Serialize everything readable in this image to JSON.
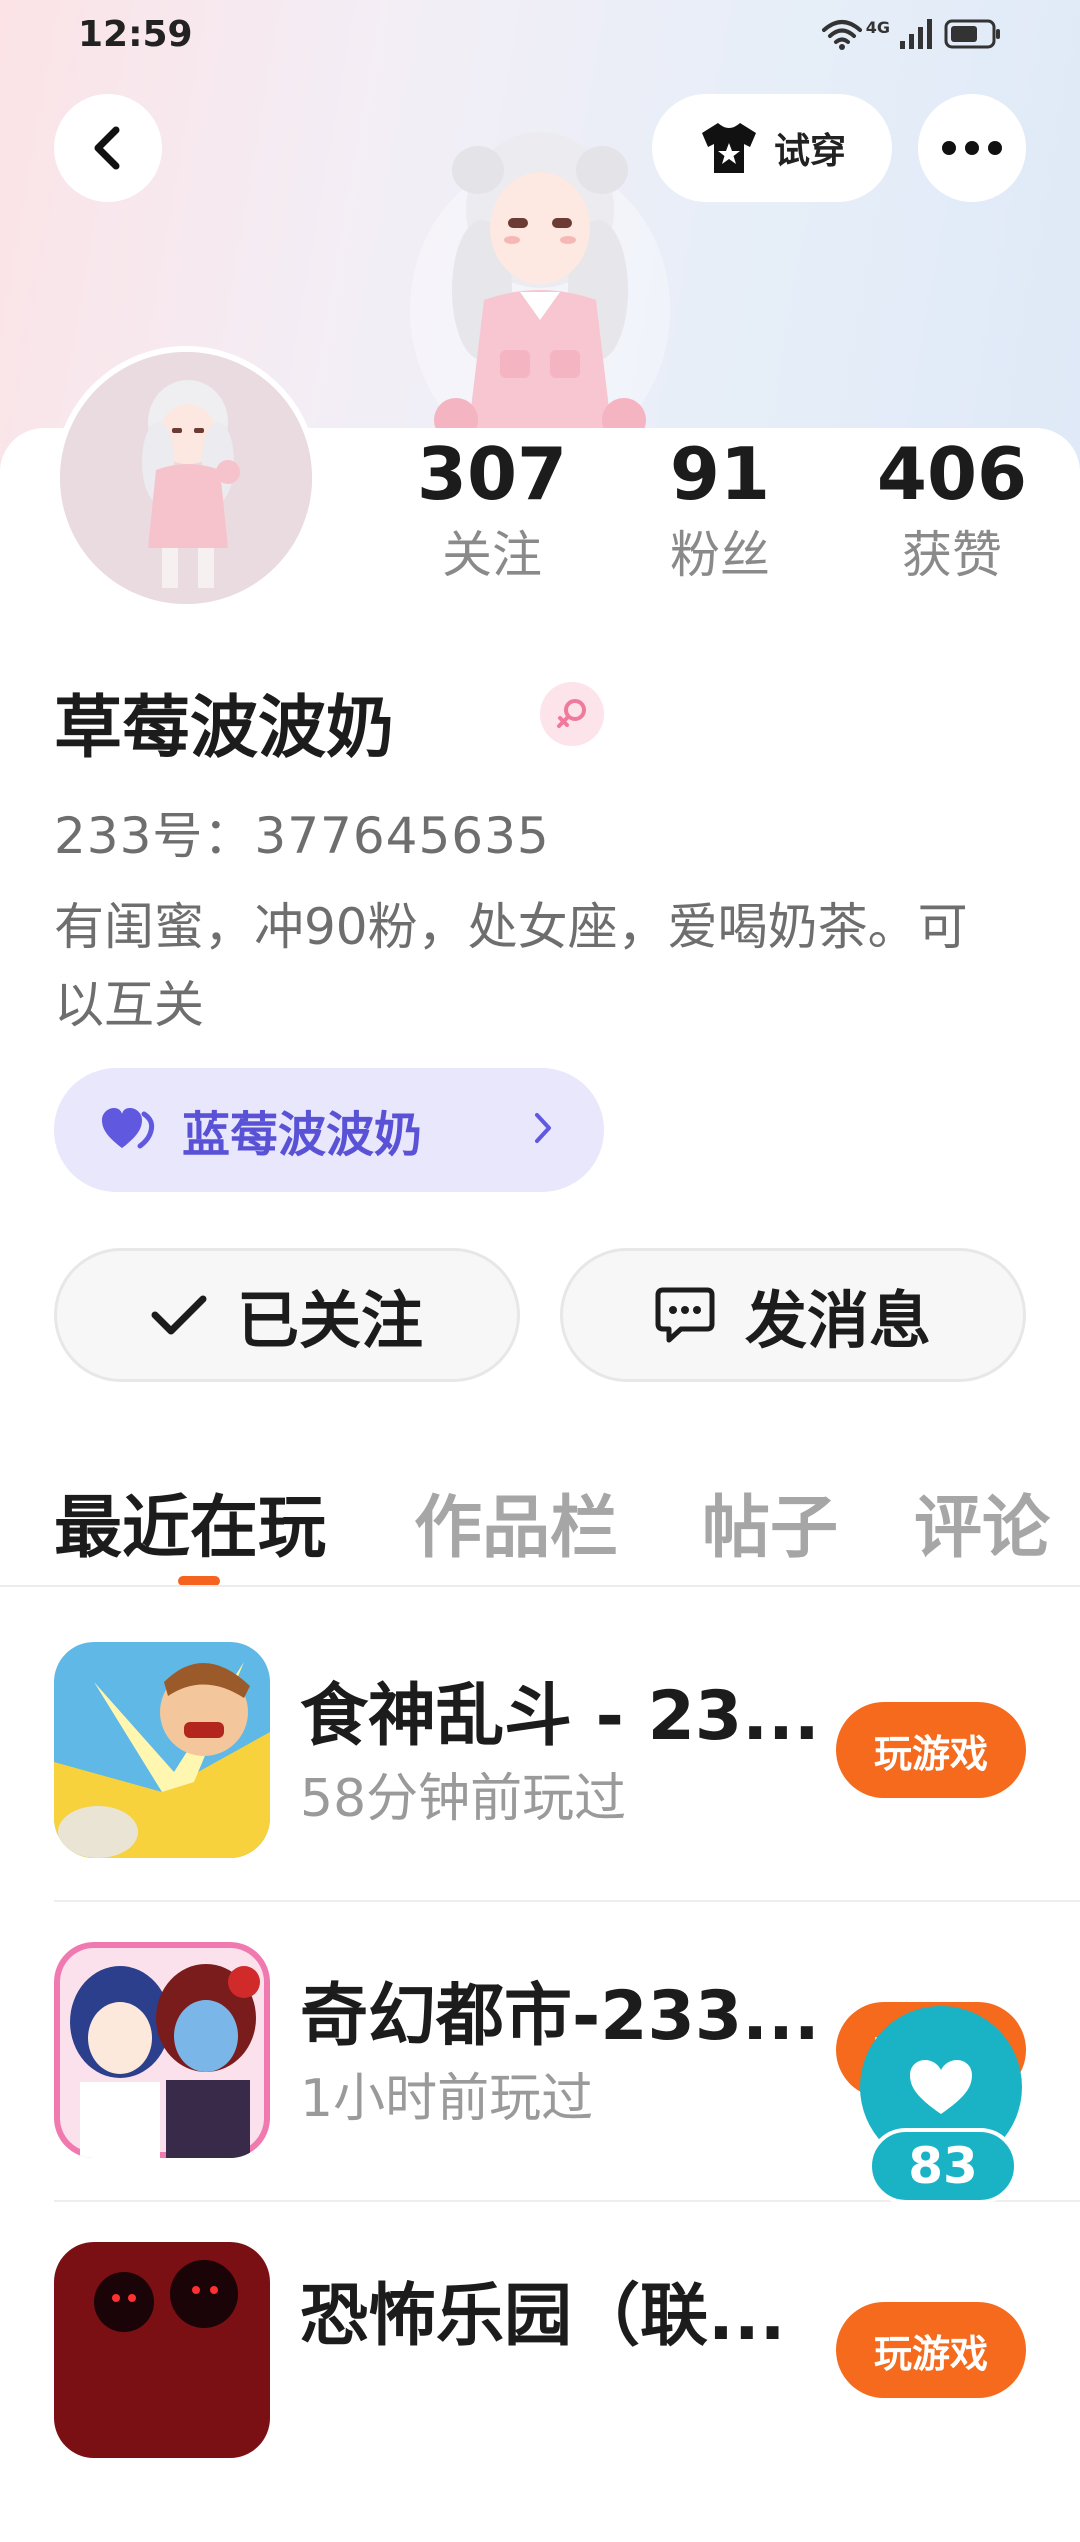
{
  "status_bar": {
    "time": "12:59",
    "network": "4G"
  },
  "header": {
    "back_icon": "back-arrow-icon",
    "try_on_label": "试穿",
    "more_icon": "more-dots-icon"
  },
  "profile": {
    "stats": [
      {
        "value": "307",
        "label": "关注"
      },
      {
        "value": "91",
        "label": "粉丝"
      },
      {
        "value": "406",
        "label": "获赞"
      }
    ],
    "username": "草莓波波奶",
    "gender_icon": "female-icon",
    "user_id": "233号：377645635",
    "bio": "有闺蜜，冲90粉，处女座，爱喝奶茶。可以互关",
    "cp_tag": {
      "label": "蓝莓波波奶",
      "icon": "heart-icon"
    },
    "follow_button_label": "已关注",
    "message_button_label": "发消息"
  },
  "tabs": [
    {
      "label": "最近在玩",
      "active": true
    },
    {
      "label": "作品栏",
      "active": false
    },
    {
      "label": "帖子",
      "active": false
    },
    {
      "label": "评论",
      "active": false
    }
  ],
  "games": [
    {
      "title": "食神乱斗 - 23...",
      "time": "58分钟前玩过",
      "button": "玩游戏"
    },
    {
      "title": "奇幻都市-233...",
      "time": "1小时前玩过",
      "button": "玩游戏"
    },
    {
      "title": "恐怖乐园（联...",
      "time": "",
      "button": "玩游戏"
    }
  ],
  "like_bubble": {
    "count": "83"
  },
  "colors": {
    "accent": "#f56a1c",
    "cp_text": "#5a52d6",
    "like_bubble": "#1ab3c6"
  }
}
